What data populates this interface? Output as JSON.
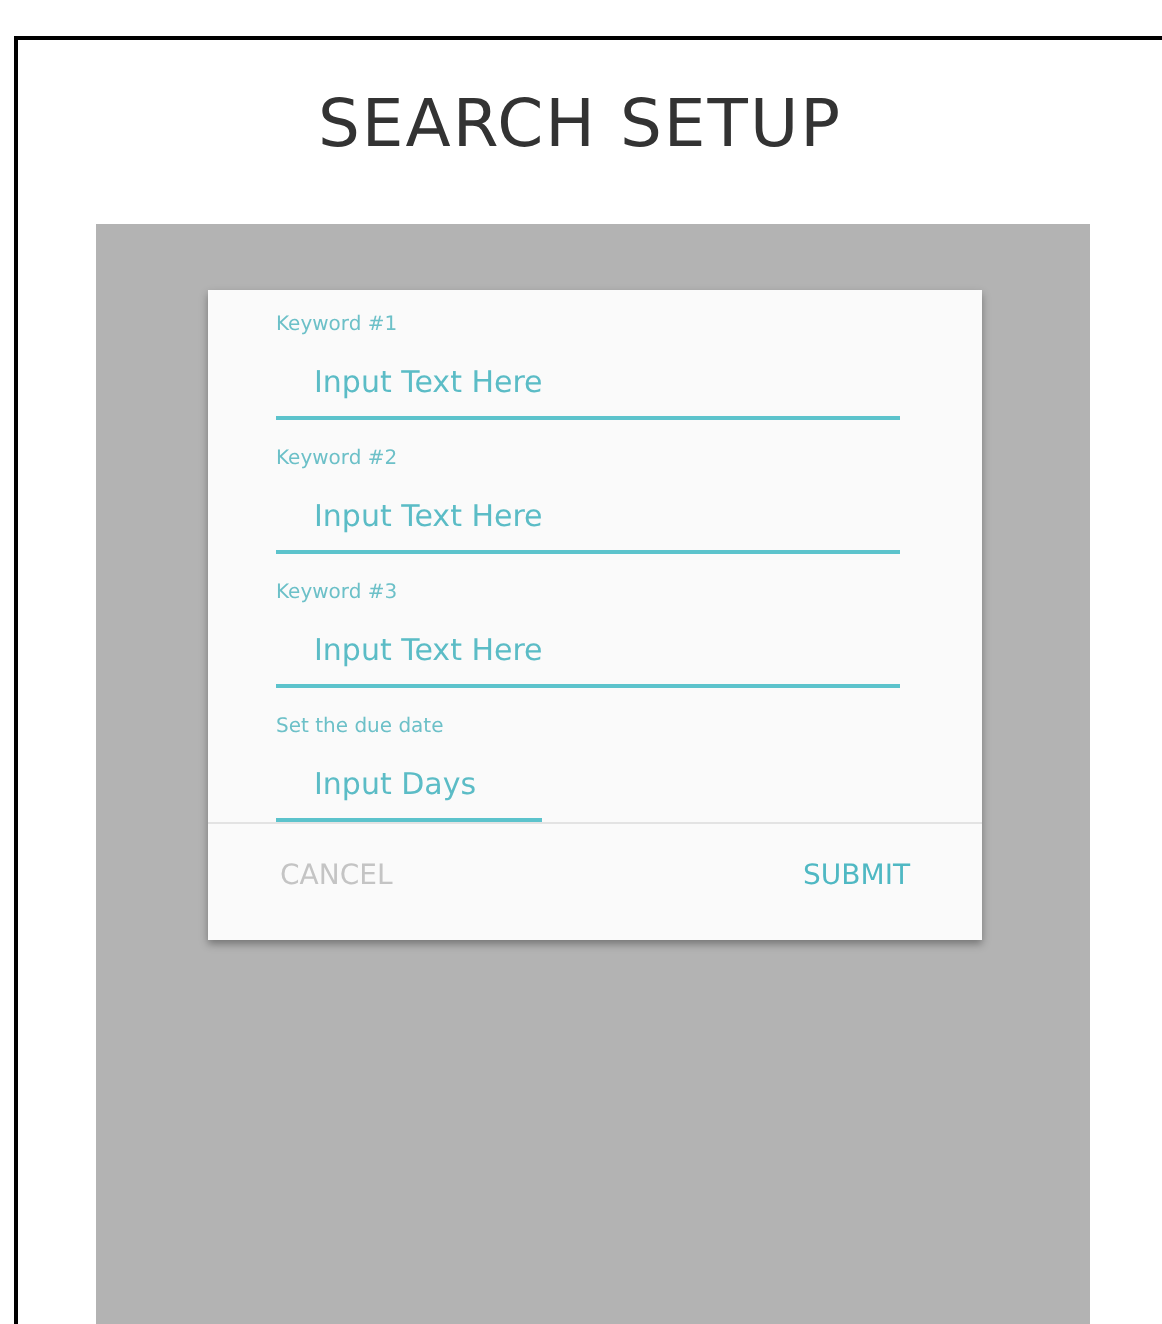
{
  "title": "SEARCH SETUP",
  "fields": [
    {
      "label": "Keyword #1",
      "placeholder": "Input Text Here",
      "kind": "wide"
    },
    {
      "label": "Keyword #2",
      "placeholder": "Input Text Here",
      "kind": "wide"
    },
    {
      "label": "Keyword #3",
      "placeholder": "Input Text Here",
      "kind": "wide"
    },
    {
      "label": "Set the due date",
      "placeholder": "Input Days",
      "kind": "short"
    }
  ],
  "buttons": [
    {
      "label": "CANCEL",
      "disabled": true
    },
    {
      "label": "SUBMIT",
      "disabled": false
    }
  ]
}
